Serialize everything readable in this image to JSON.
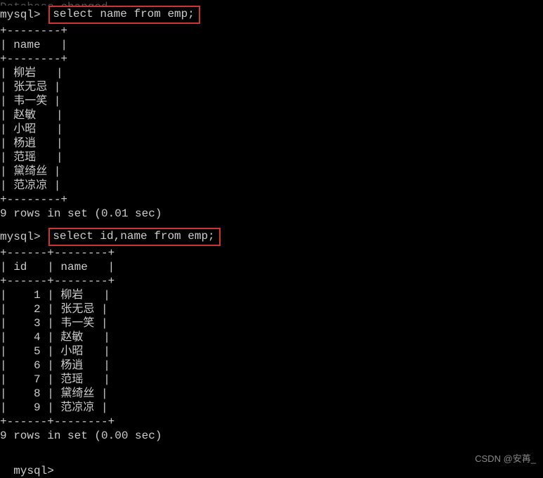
{
  "toptext": "Database changed",
  "prompt": "mysql>",
  "query1": {
    "command": "select name from emp;",
    "border_top": "+--------+",
    "header_row": "| name   |",
    "border_mid": "+--------+",
    "rows": [
      "| 柳岩   |",
      "| 张无忌 |",
      "| 韦一笑 |",
      "| 赵敏   |",
      "| 小昭   |",
      "| 杨逍   |",
      "| 范瑶   |",
      "| 黛绮丝 |",
      "| 范凉凉 |"
    ],
    "border_bottom": "+--------+",
    "summary": "9 rows in set (0.01 sec)"
  },
  "query2": {
    "command": "select id,name from emp;",
    "border_top": "+------+--------+",
    "header_row": "| id   | name   |",
    "border_mid": "+------+--------+",
    "rows": [
      "|    1 | 柳岩   |",
      "|    2 | 张无忌 |",
      "|    3 | 韦一笑 |",
      "|    4 | 赵敏   |",
      "|    5 | 小昭   |",
      "|    6 | 杨逍   |",
      "|    7 | 范瑶   |",
      "|    8 | 黛绮丝 |",
      "|    9 | 范凉凉 |"
    ],
    "border_bottom": "+------+--------+",
    "summary": "9 rows in set (0.00 sec)"
  },
  "watermark": "CSDN @安苒_"
}
